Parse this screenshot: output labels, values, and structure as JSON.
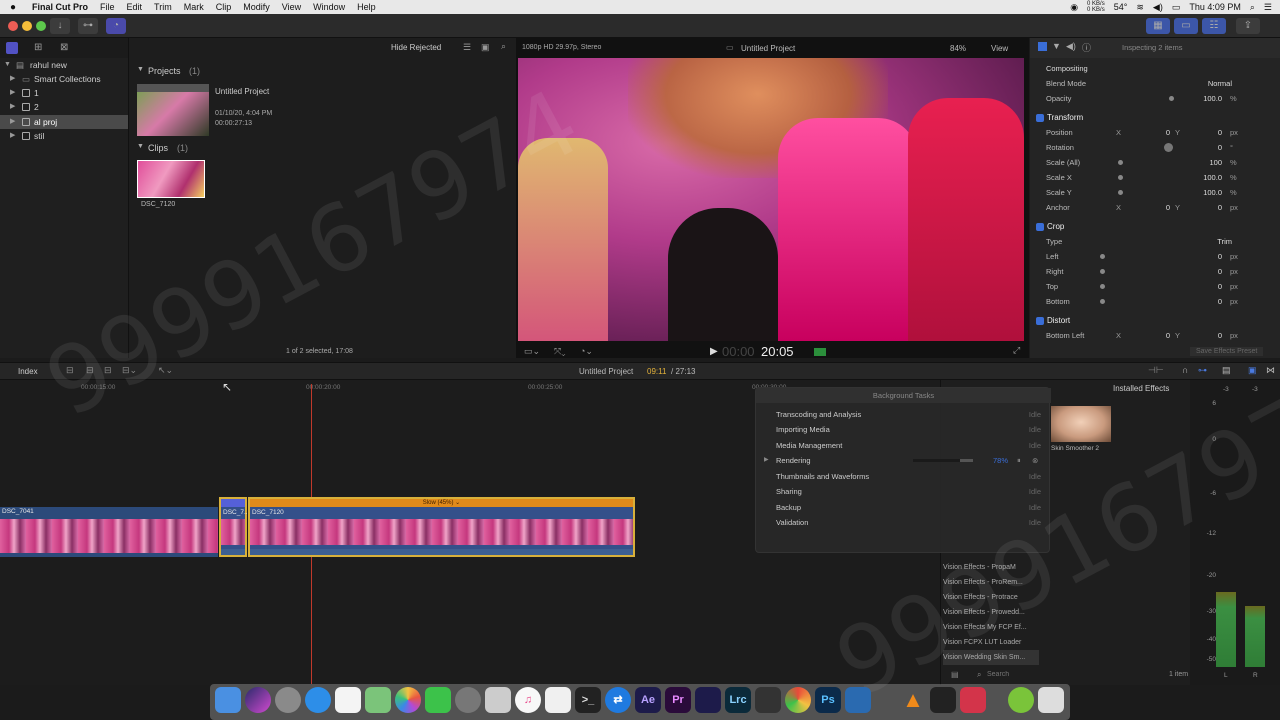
{
  "menubar": {
    "app": "Final Cut Pro",
    "menus": [
      "File",
      "Edit",
      "Trim",
      "Mark",
      "Clip",
      "Modify",
      "View",
      "Window",
      "Help"
    ],
    "net_up": "0 KB/s",
    "net_down": "0 KB/s",
    "temp": "54°",
    "clock": "Thu 4:09 PM"
  },
  "sidebar": {
    "library": "rahul new",
    "items": [
      "Smart Collections",
      "1",
      "2",
      "al proj",
      "stil"
    ]
  },
  "browser": {
    "filter": "Hide Rejected",
    "format": "1080p HD 29.97p, Stereo",
    "projects_heading": "Projects",
    "projects_count": "(1)",
    "project_name": "Untitled Project",
    "project_date": "01/10/20, 4:04 PM",
    "project_duration": "00:00:27:13",
    "clips_heading": "Clips",
    "clips_count": "(1)",
    "clip_name": "DSC_7120",
    "status": "1 of 2 selected, 17:08"
  },
  "viewer": {
    "title": "Untitled Project",
    "zoom": "84%",
    "view": "View",
    "timecode_dim": "00:00",
    "timecode": "20:05"
  },
  "inspector": {
    "header": "Inspecting 2 items",
    "compositing": "Compositing",
    "blend_mode_label": "Blend Mode",
    "blend_mode": "Normal",
    "opacity_label": "Opacity",
    "opacity": "100.0",
    "transform": "Transform",
    "position_label": "Position",
    "pos_x": "0",
    "pos_y": "0",
    "rotation_label": "Rotation",
    "rotation": "0",
    "scale_all_label": "Scale (All)",
    "scale_all": "100",
    "scale_x_label": "Scale X",
    "scale_x": "100.0",
    "scale_y_label": "Scale Y",
    "scale_y": "100.0",
    "anchor_label": "Anchor",
    "anchor_x": "0",
    "anchor_y": "0",
    "crop": "Crop",
    "type_label": "Type",
    "type": "Trim",
    "left_label": "Left",
    "left": "0",
    "right_label": "Right",
    "right": "0",
    "top_label": "Top",
    "top": "0",
    "bottom_label": "Bottom",
    "bottom": "0",
    "distort": "Distort",
    "bottom_left_label": "Bottom Left",
    "bl_x": "0",
    "bl_y": "0",
    "save_preset": "Save Effects Preset",
    "unit_px": "px",
    "unit_pct": "%",
    "unit_deg": "°",
    "axis_x": "X",
    "axis_y": "Y"
  },
  "timeline": {
    "index": "Index",
    "project": "Untitled Project",
    "position": "09:11",
    "duration": "/ 27:13",
    "ruler": [
      "00:00:15:00",
      "00:00:20:00",
      "00:00:25:00",
      "00:00:30:00"
    ],
    "clip_a": "DSC_7041",
    "clip_b": "DSC_7...",
    "clip_c": "DSC_7120",
    "retime": "Slow (45%)"
  },
  "bg_tasks": {
    "title": "Background Tasks",
    "tasks": [
      {
        "name": "Transcoding and Analysis",
        "status": "Idle"
      },
      {
        "name": "Importing Media",
        "status": "Idle"
      },
      {
        "name": "Media Management",
        "status": "Idle"
      },
      {
        "name": "Rendering",
        "status": "78%"
      },
      {
        "name": "Thumbnails and Waveforms",
        "status": "Idle"
      },
      {
        "name": "Sharing",
        "status": "Idle"
      },
      {
        "name": "Backup",
        "status": "Idle"
      },
      {
        "name": "Validation",
        "status": "Idle"
      }
    ],
    "rendering_progress": 0.78
  },
  "effects": {
    "header": "Installed Effects",
    "effect_name": "Skin Smoother 2",
    "list": [
      "Vision Effects - PropaM",
      "Vision Effects - ProRem...",
      "Vision Effects - Protrace",
      "Vision Effects - Prowedd...",
      "Vision Effects My FCP Ef...",
      "Vision FCPX LUT Loader",
      "Vision Wedding Skin Sm..."
    ],
    "search_placeholder": "Search",
    "count": "1 item"
  },
  "meters": {
    "scale": [
      "6",
      "0",
      "-6",
      "-12",
      "-20",
      "-30",
      "-40",
      "-50"
    ],
    "top_l": "-3",
    "top_r": "-3",
    "label_l": "L",
    "label_r": "R",
    "level_l": 0.62,
    "level_r": 0.57
  },
  "dock": {
    "apps": [
      "Finder",
      "Siri",
      "Launchpad",
      "Safari",
      "Calendar",
      "Maps",
      "Photos",
      "FaceTime",
      "System Preferences",
      "Preview",
      "iTunes",
      "TextEdit",
      "Terminal",
      "TeamViewer",
      "Ae",
      "Pr",
      "Media Encoder",
      "Lrc",
      "Activity Monitor",
      "Chrome",
      "Ps",
      "Photo Booth",
      "VLC",
      "Final Cut Pro",
      "App",
      "Android File Transfer",
      "Trash"
    ]
  },
  "watermark": "9999167974",
  "colors": {
    "accent": "#3a6ed8",
    "clip_border": "#d8b03a",
    "retime": "#e08a1a",
    "playhead": "#c0392b",
    "render_progress": "#3a6ed8"
  }
}
